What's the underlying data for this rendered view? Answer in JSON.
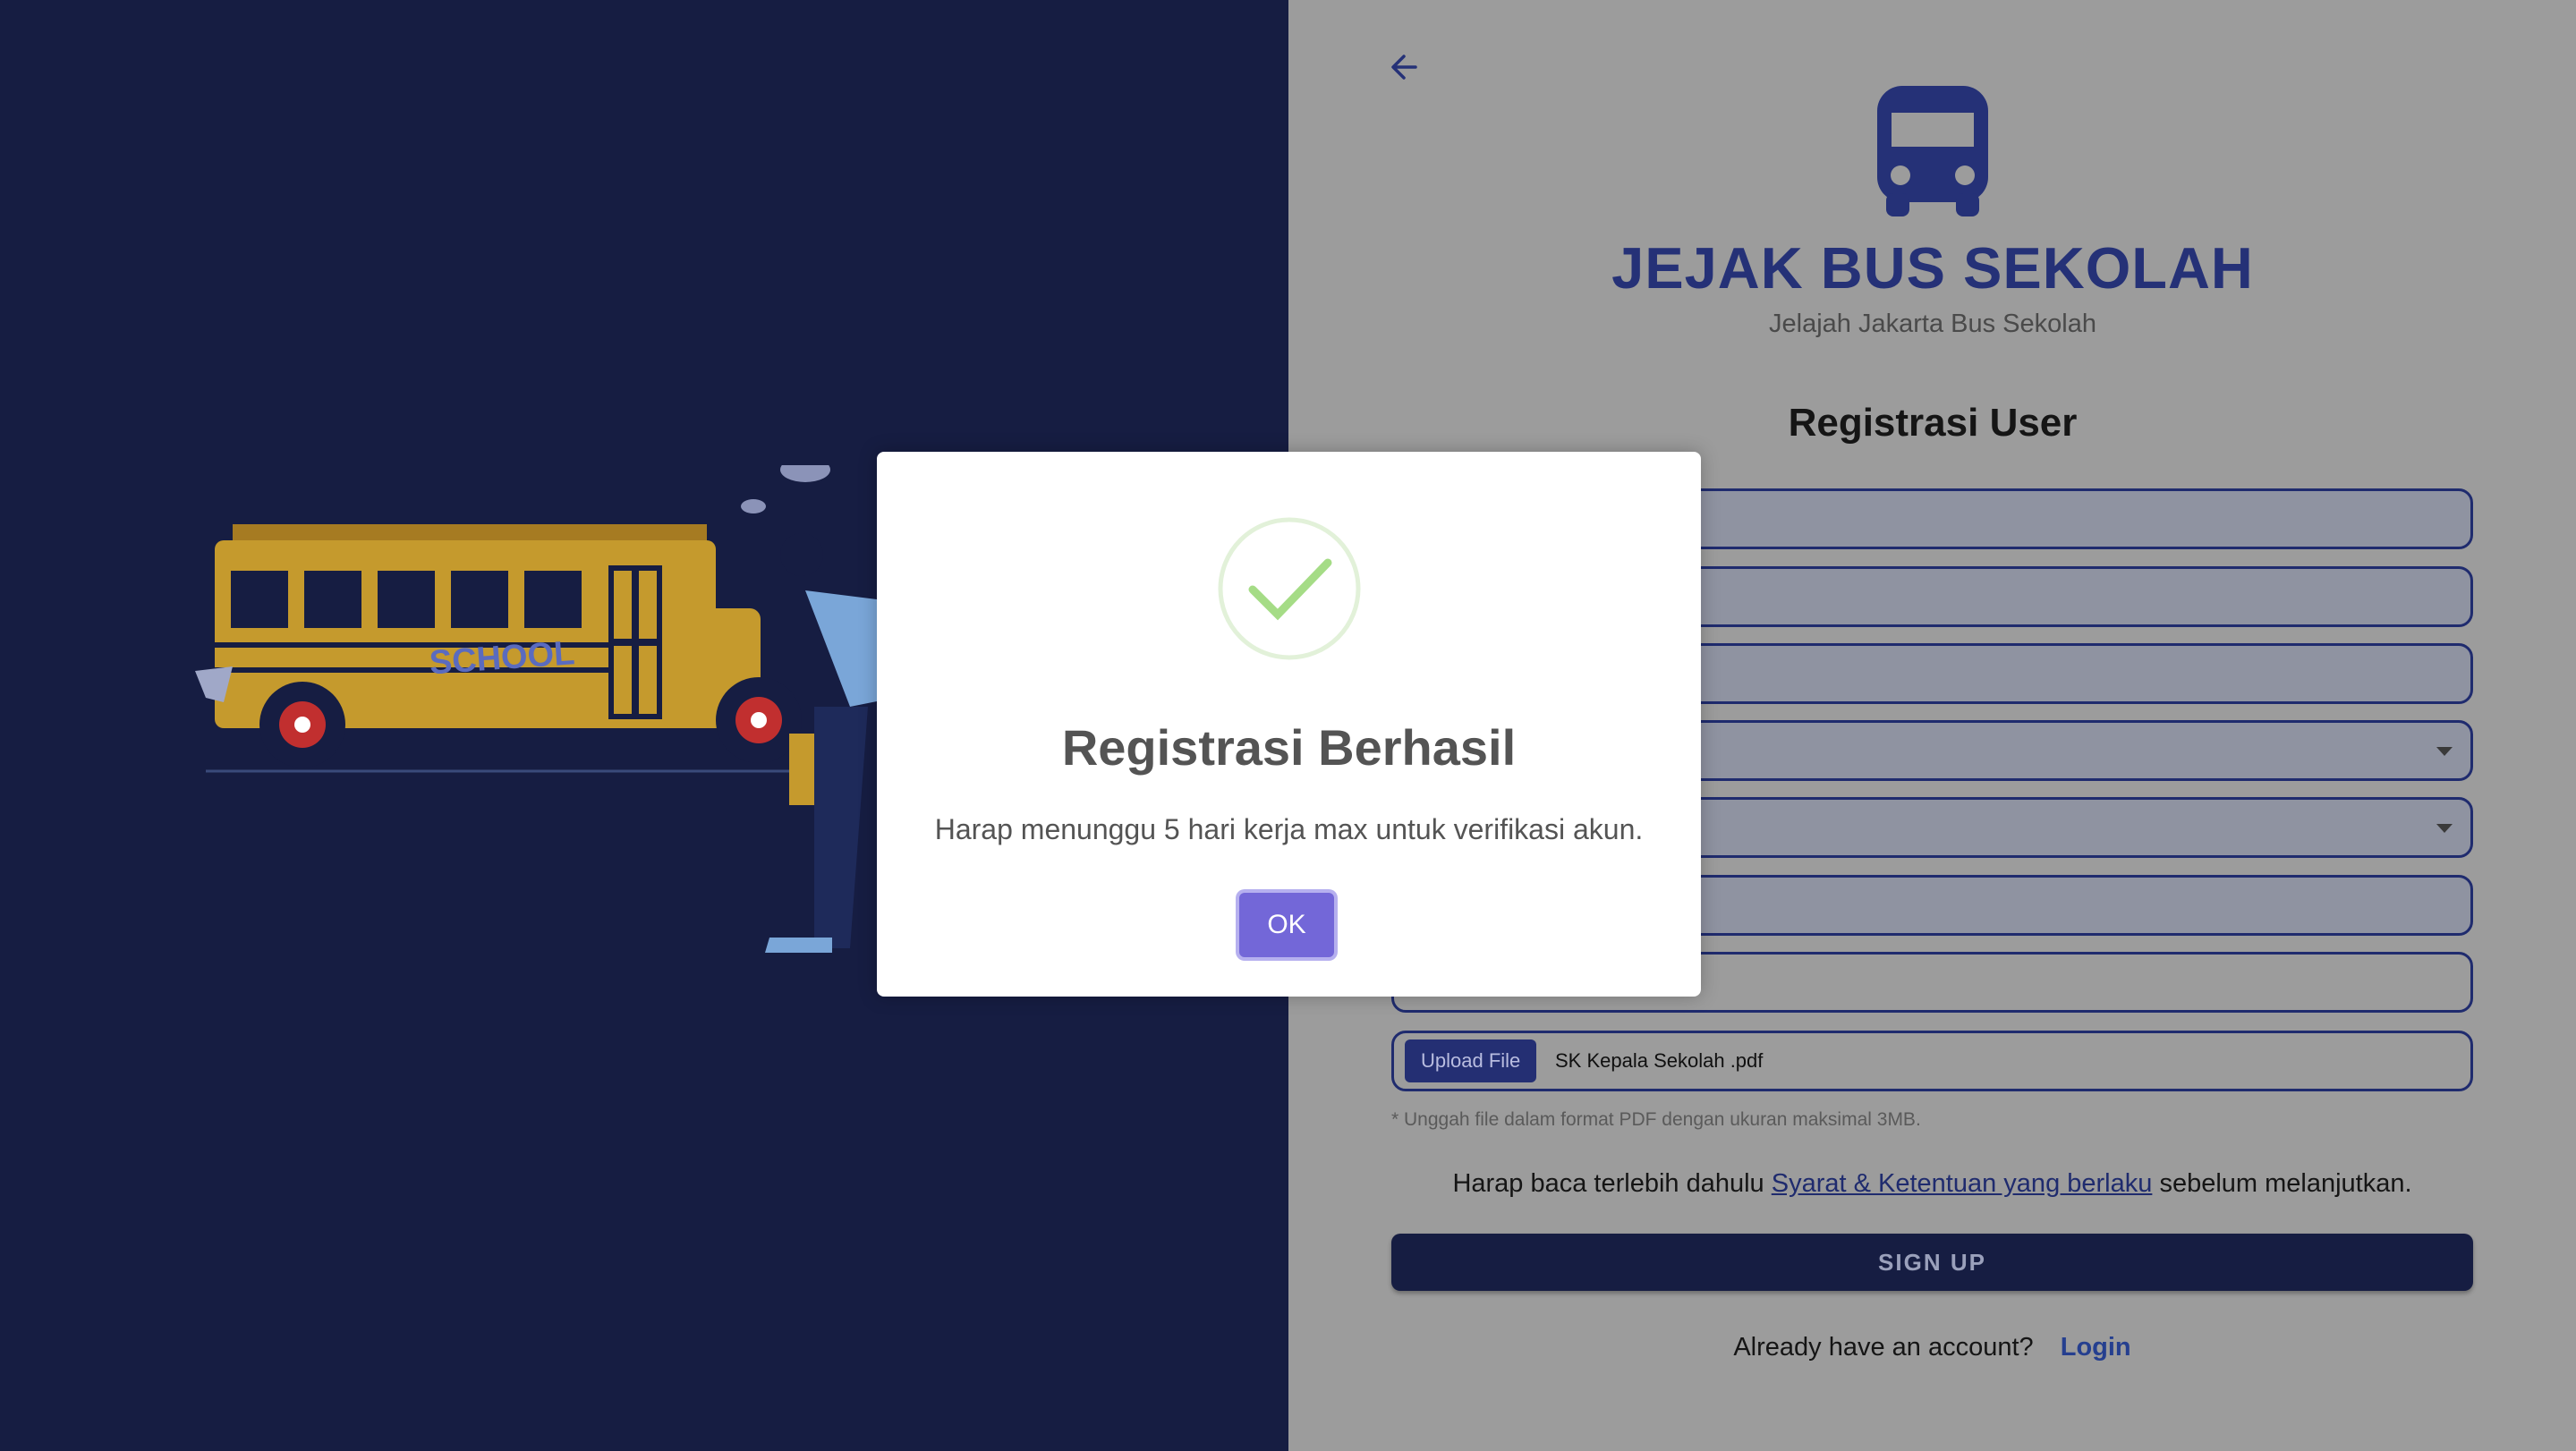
{
  "brand": {
    "title": "JEJAK BUS SEKOLAH",
    "subtitle": "Jelajah Jakarta Bus Sekolah",
    "logo_icon": "bus-icon"
  },
  "form": {
    "title": "Registrasi User",
    "upload_button_label": "Upload File",
    "upload_file_name": "SK Kepala Sekolah .pdf",
    "upload_hint": "* Unggah file dalam format PDF dengan ukuran maksimal 3MB.",
    "terms_prefix": "Harap baca terlebih dahulu",
    "terms_link": "Syarat & Ketentuan yang berlaku",
    "terms_suffix": "sebelum melanjutkan.",
    "signup_label": "SIGN UP",
    "account_question": "Already have an account?",
    "login_label": "Login"
  },
  "illustration": {
    "bus_sign_text": "SCHOOL"
  },
  "modal": {
    "title": "Registrasi Berhasil",
    "message": "Harap menunggu 5 hari kerja max untuk verifikasi akun.",
    "ok_label": "OK",
    "icon": "check-circle-icon"
  },
  "colors": {
    "left_bg": "#161d42",
    "right_bg": "#9c9c9c",
    "brand_blue": "#253177",
    "ok_button": "#7367d8",
    "success_green": "#a5dc86"
  }
}
